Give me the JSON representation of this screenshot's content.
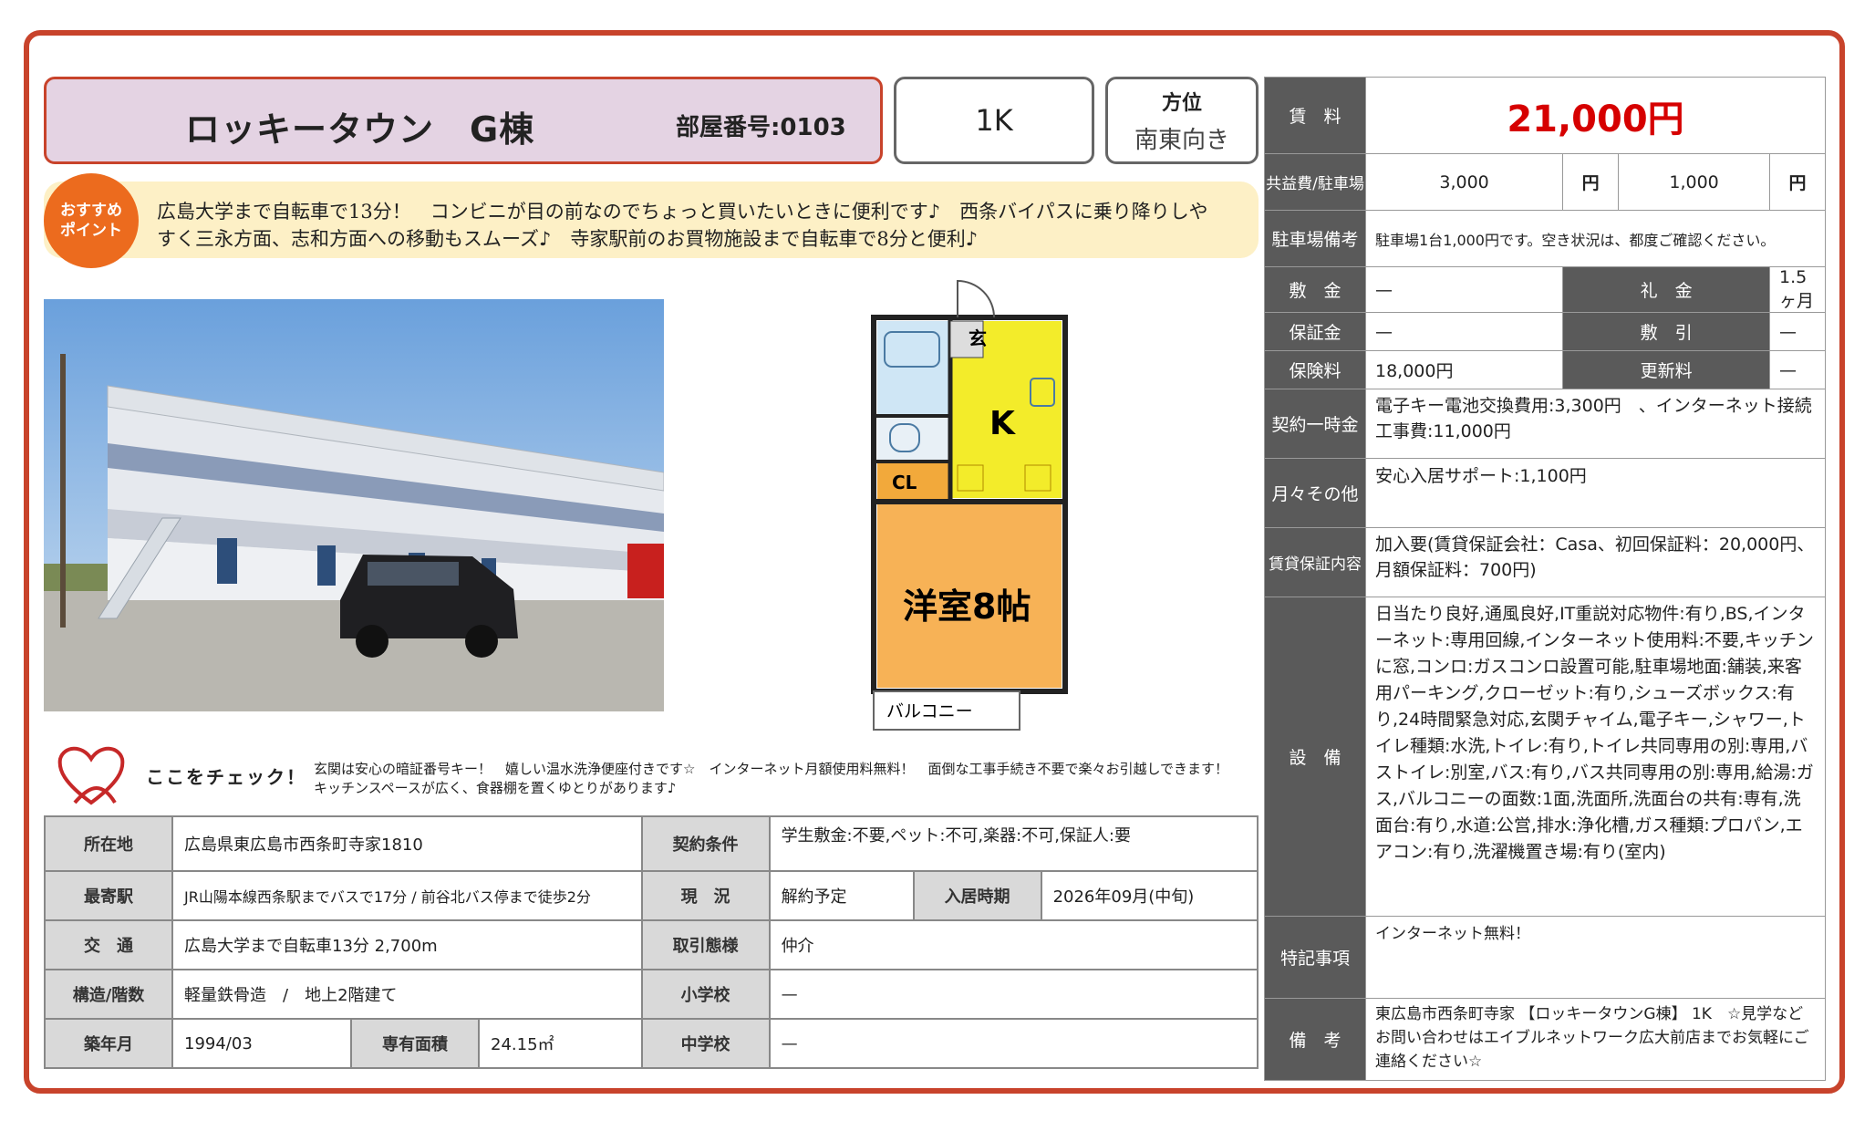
{
  "header": {
    "building_name": "ロッキータウン　G棟",
    "room_number": "部屋番号:0103",
    "layout": "1K",
    "direction_label": "方位",
    "direction_value": "南東向き"
  },
  "recommend": {
    "badge_line1": "おすすめ",
    "badge_line2": "ポイント",
    "text": "広島大学まで自転車で13分！　コンビニが目の前なのでちょっと買いたいときに便利です♪　西条バイパスに乗り降りしやすく三永方面、志和方面への移動もスムーズ♪　寺家駅前のお買物施設まで自転車で8分と便利♪"
  },
  "floorplan": {
    "entrance": "玄",
    "kitchen": "K",
    "closet": "CL",
    "room": "洋室8帖",
    "balcony": "バルコニー"
  },
  "check": {
    "title": "ここをチェック！",
    "text": "玄関は安心の暗証番号キー！　嬉しい温水洗浄便座付きです☆　インターネット月額使用料無料！　面倒な工事手続き不要で楽々お引越しできます！　キッチンスペースが広く、食器棚を置くゆとりがあります♪"
  },
  "info": {
    "address_label": "所在地",
    "address": "広島県東広島市西条町寺家1810",
    "contract_label": "契約条件",
    "contract": "学生敷金:不要,ペット:不可,楽器:不可,保証人:要",
    "station_label": "最寄駅",
    "station": "JR山陽本線西条駅までバスで17分 / 前谷北バス停まで徒歩2分",
    "status_label": "現　況",
    "status": "解約予定",
    "move_label": "入居時期",
    "move": "2026年09月(中旬)",
    "traffic_label": "交　通",
    "traffic": "広島大学まで自転車13分 2,700m",
    "deal_label": "取引態様",
    "deal": "仲介",
    "structure_label": "構造/階数",
    "structure": "軽量鉄骨造　/　地上2階建て",
    "elem_label": "小学校",
    "elem": "—",
    "built_label": "築年月",
    "built": "1994/03",
    "area_label": "専有面積",
    "area": "24.15㎡",
    "junior_label": "中学校",
    "junior": "—"
  },
  "price": {
    "rent_label": "賃　料",
    "rent": "21,000円",
    "fee_label": "共益費/駐車場",
    "common_fee": "3,000",
    "yen1": "円",
    "parking_fee": "1,000",
    "yen2": "円",
    "parking_note_label": "駐車場備考",
    "parking_note": "駐車場1台1,000円です。空き状況は、都度ご確認ください。",
    "deposit_label": "敷　金",
    "deposit": "—",
    "key_money_label": "礼　金",
    "key_money": "1.5ヶ月",
    "guarantee_label": "保証金",
    "guarantee": "—",
    "shikibiki_label": "敷　引",
    "shikibiki": "—",
    "insurance_label": "保険料",
    "insurance": "18,000円",
    "renewal_label": "更新料",
    "renewal": "—",
    "onetime_label": "契約一時金",
    "onetime": "電子キー電池交換費用:3,300円　、インターネット接続工事費:11,000円",
    "monthly_label": "月々その他",
    "monthly": "安心入居サポート:1,100円",
    "guarantor_label": "賃貸保証内容",
    "guarantor": "加入要(賃貸保証会社：Casa、初回保証料：20,000円、月額保証料：700円)",
    "equipment_label": "設　備",
    "equipment": "日当たり良好,通風良好,IT重説対応物件:有り,BS,インターネット:専用回線,インターネット使用料:不要,キッチンに窓,コンロ:ガスコンロ設置可能,駐車場地面:舗装,来客用パーキング,クローゼット:有り,シューズボックス:有り,24時間緊急対応,玄関チャイム,電子キー,シャワー,トイレ種類:水洗,トイレ:有り,トイレ共同専用の別:専用,バストイレ:別室,バス:有り,バス共同専用の別:専用,給湯:ガス,バルコニーの面数:1面,洗面所,洗面台の共有:専有,洗面台:有り,水道:公営,排水:浄化槽,ガス種類:プロパン,エアコン:有り,洗濯機置き場:有り(室内)",
    "special_label": "特記事項",
    "special": "インターネット無料！",
    "remarks_label": "備　考",
    "remarks": "東広島市西条町寺家 【ロッキータウンG棟】 1K　☆見学などお問い合わせはエイブルネットワーク広大前店までお気軽にご連絡ください☆"
  },
  "colors": {
    "accent": "#c8432b",
    "rent": "#d60000",
    "badge": "#ec6b1e",
    "header_cell": "#5a5a5a"
  }
}
